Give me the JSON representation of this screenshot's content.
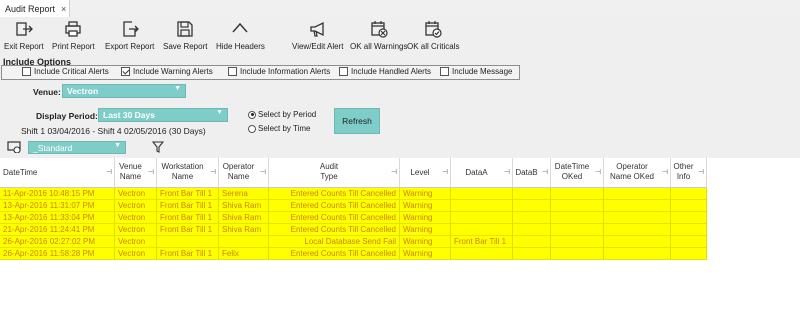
{
  "tab": {
    "title": "Audit Report",
    "close": "×"
  },
  "toolbar": [
    {
      "label": "Exit Report",
      "icon": "exit-icon"
    },
    {
      "label": "Print Report",
      "icon": "printer-icon"
    },
    {
      "label": "Export Report",
      "icon": "export-icon"
    },
    {
      "label": "Save Report",
      "icon": "save-icon"
    },
    {
      "label": "Hide Headers",
      "icon": "chevron-up-icon"
    },
    {
      "label": "View/Edit Alert",
      "icon": "megaphone-icon"
    },
    {
      "label": "OK all Warnings",
      "icon": "calendar-x-icon"
    },
    {
      "label": "OK all Criticals",
      "icon": "calendar-check-icon"
    }
  ],
  "options": {
    "title": "Include Options",
    "items": [
      {
        "label": "Include Critical Alerts",
        "checked": false
      },
      {
        "label": "Include Warning Alerts",
        "checked": true
      },
      {
        "label": "Include Information Alerts",
        "checked": false
      },
      {
        "label": "Include Handled Alerts",
        "checked": false
      },
      {
        "label": "Include  Message",
        "checked": false
      }
    ]
  },
  "venue": {
    "label": "Venue:",
    "value": "Vectron"
  },
  "period": {
    "label": "Display Period:",
    "value": "Last 30 Days",
    "range_text": "Shift 1 03/04/2016 - Shift 4 02/05/2016 (30 Days)",
    "radio_period": "Select by Period",
    "radio_time": "Select  by Time",
    "selected": "period"
  },
  "refresh_label": "Refresh",
  "layout_select": {
    "value": "_Standard",
    "icon": "filter-icon"
  },
  "columns": [
    {
      "line1": "DateTime",
      "line2": ""
    },
    {
      "line1": "Venue",
      "line2": "Name"
    },
    {
      "line1": "Workstation",
      "line2": "Name"
    },
    {
      "line1": "Operator",
      "line2": "Name"
    },
    {
      "line1": "Audit",
      "line2": "Type"
    },
    {
      "line1": "Level",
      "line2": ""
    },
    {
      "line1": "DataA",
      "line2": ""
    },
    {
      "line1": "DataB",
      "line2": ""
    },
    {
      "line1": "DateTime",
      "line2": "OKed"
    },
    {
      "line1": "Operator",
      "line2": "Name OKed"
    },
    {
      "line1": "Other",
      "line2": "Info"
    }
  ],
  "rows": [
    [
      "11-Apr-2016 10:48:15 PM",
      "Vectron",
      "Front Bar Till 1",
      "Serena",
      "Entered Counts Till Cancelled",
      "Warning",
      "",
      "",
      "",
      "",
      ""
    ],
    [
      "13-Apr-2016 11:31:07 PM",
      "Vectron",
      "Front Bar Till 1",
      "Shiva  Ram",
      "Entered Counts Till Cancelled",
      "Warning",
      "",
      "",
      "",
      "",
      ""
    ],
    [
      "13-Apr-2016 11:33:04 PM",
      "Vectron",
      "Front Bar Till 1",
      "Shiva  Ram",
      "Entered Counts Till Cancelled",
      "Warning",
      "",
      "",
      "",
      "",
      ""
    ],
    [
      "21-Apr-2016 11:24:41 PM",
      "Vectron",
      "Front Bar Till 1",
      "Shiva  Ram",
      "Entered Counts Till Cancelled",
      "Warning",
      "",
      "",
      "",
      "",
      ""
    ],
    [
      "26-Apr-2016 02:27:02 PM",
      "Vectron",
      "",
      "",
      "Local Database Send Fail",
      "Warning",
      "Front Bar Till 1",
      "",
      "",
      "",
      ""
    ],
    [
      "26-Apr-2016 11:58:28 PM",
      "Vectron",
      "Front Bar Till 1",
      "Felix",
      "Entered Counts Till Cancelled",
      "Warning",
      "",
      "",
      "",
      "",
      ""
    ]
  ],
  "colors": {
    "accent": "#7fcdc9",
    "row_bg": "#ffff00",
    "row_text": "#c7870e"
  }
}
